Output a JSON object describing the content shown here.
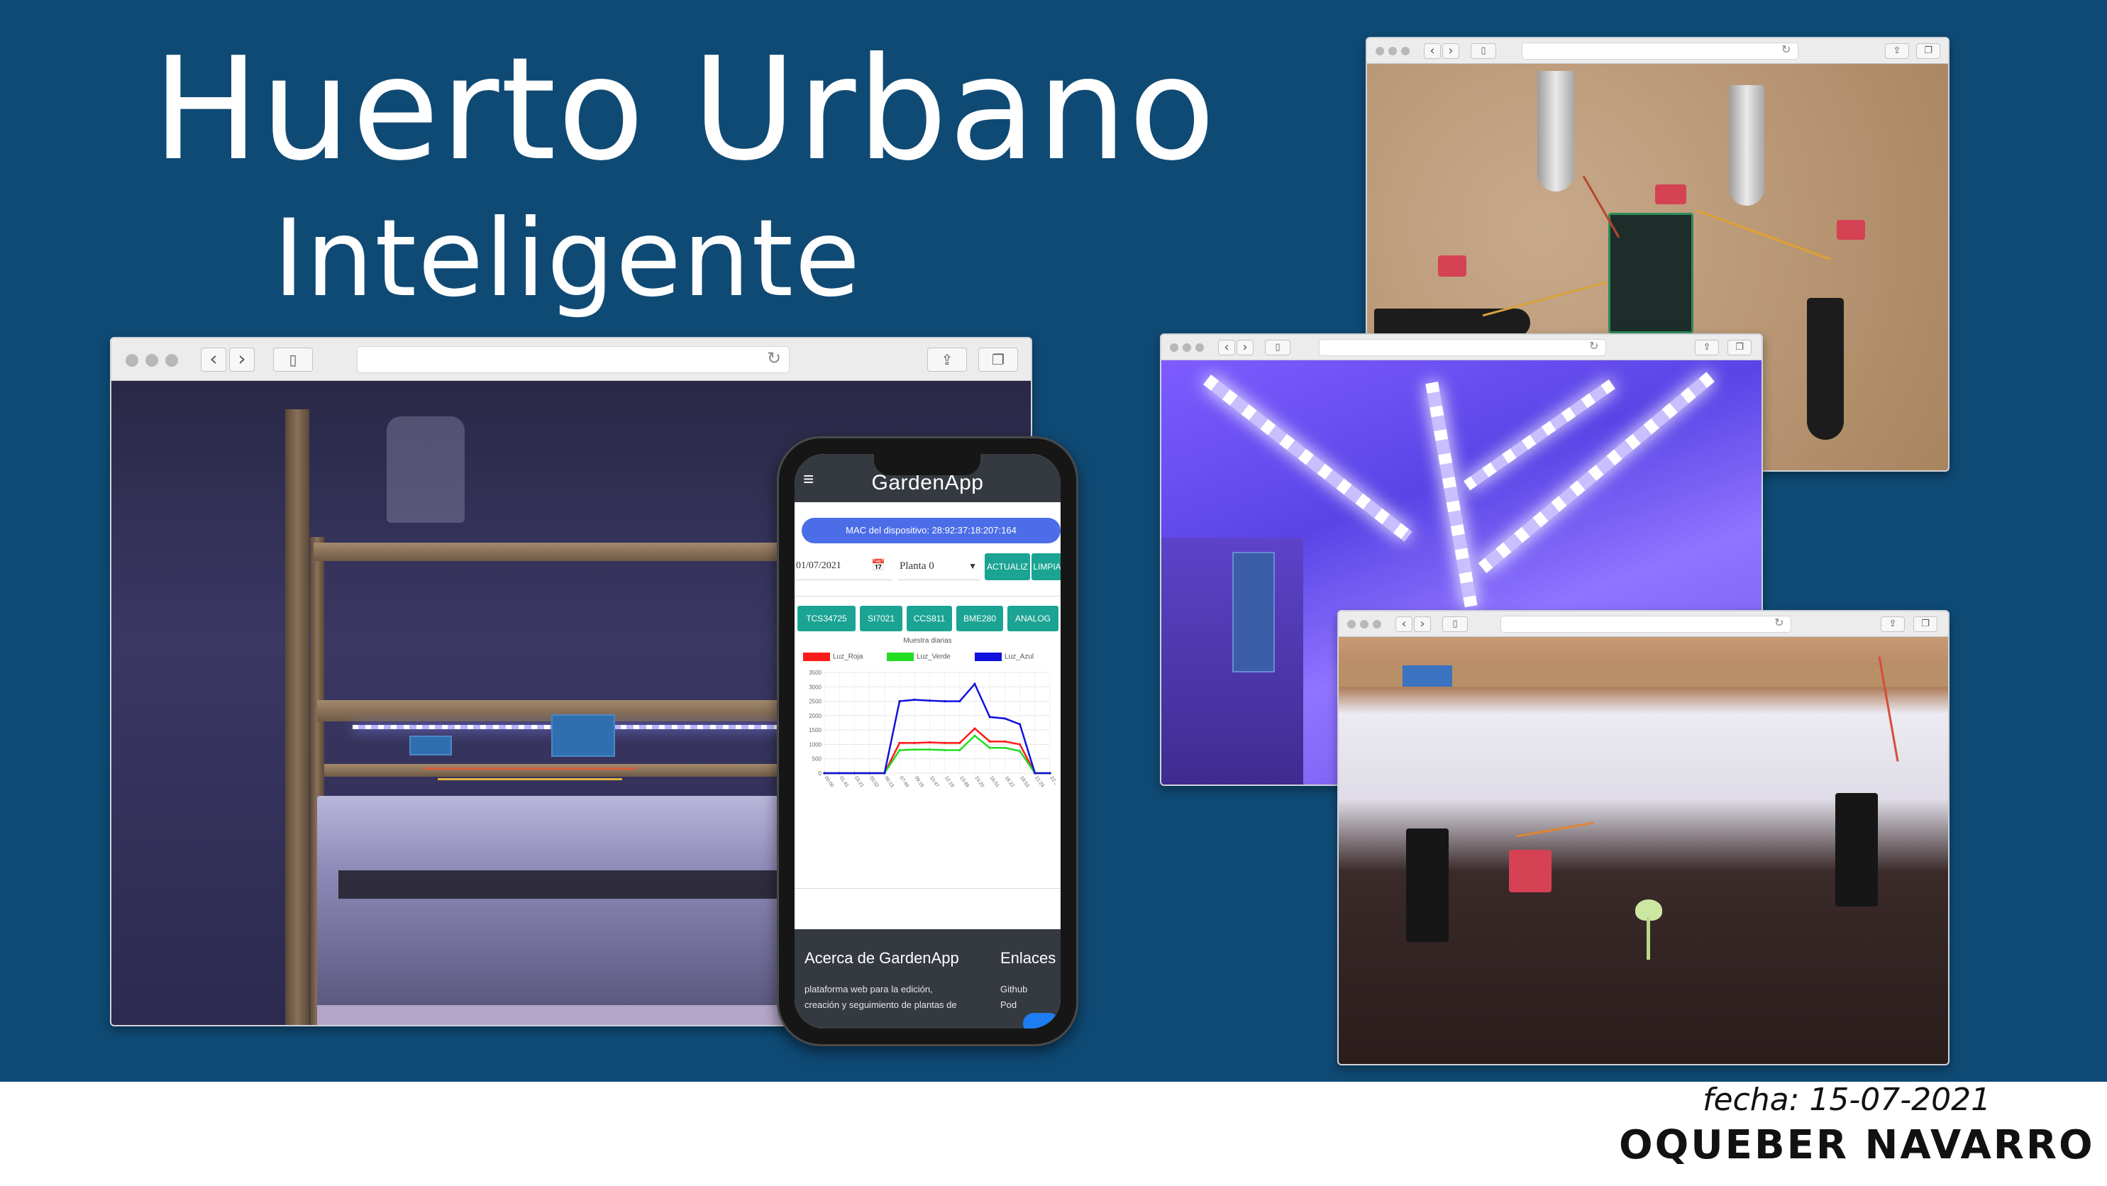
{
  "slide": {
    "title_line1": "Huerto Urbano",
    "title_line2": "Inteligente",
    "date_text": "fecha: 15-07-2021",
    "author": "OQUEBER NAVARRO",
    "colors": {
      "banner": "#0f4a75",
      "footer": "#ffffff"
    }
  },
  "browser": {
    "nav_back_icon": "chevron-left-icon",
    "nav_forward_icon": "chevron-right-icon",
    "reload_icon": "reload-icon",
    "share_icon": "share-icon",
    "tabs_icon": "tabs-icon",
    "back_glyph": "‹",
    "forward_glyph": "›",
    "reload_glyph": "↻",
    "share_glyph": "⇪",
    "tabs_glyph": "❐",
    "sidebar_glyph": "▯"
  },
  "app": {
    "title": "GardenApp",
    "menu_glyph": "≡",
    "mac_label": "MAC del dispositivo: 28:92:37:18:207:164",
    "date_value": "01/07/2021",
    "calendar_glyph": "📅",
    "plant_value": "Planta 0",
    "caret_glyph": "▼",
    "buttons_top": [
      "ACTUALIZ",
      "LIMPIA"
    ],
    "sensor_tabs": [
      "TCS34725",
      "SI7021",
      "CCS811",
      "BME280",
      "ANALOG"
    ],
    "chart_title": "Muestra diarias",
    "footer_about_title": "Acerca de GardenApp",
    "footer_about_text_1": "plataforma web para la edición,",
    "footer_about_text_2": "creación y seguimiento de plantas de",
    "footer_links_title": "Enlaces",
    "footer_link_1": "Github",
    "footer_link_2": "Pod",
    "colors": {
      "header": "#343a40",
      "mac_pill": "#4c6de8",
      "buttons": "#1ba493"
    }
  },
  "chart_data": {
    "type": "line",
    "title": "Muestra diarias",
    "xlabel": "",
    "ylabel": "",
    "ylim": [
      0,
      3500
    ],
    "yticks": [
      0,
      500,
      1000,
      1500,
      2000,
      2500,
      3000,
      3500
    ],
    "x": [
      "00:00",
      "01:41",
      "03:21",
      "05:02",
      "06:13",
      "07:44",
      "09:16",
      "10:47",
      "12:19",
      "13:49",
      "15:20",
      "16:51",
      "18:22",
      "19:53",
      "21:24",
      "22:55"
    ],
    "series": [
      {
        "name": "Luz_Roja",
        "color": "#ff1a1a",
        "values": [
          0,
          0,
          0,
          0,
          0,
          1050,
          1050,
          1070,
          1050,
          1050,
          1550,
          1100,
          1100,
          1000,
          0,
          0
        ]
      },
      {
        "name": "Luz_Verde",
        "color": "#22dd22",
        "values": [
          0,
          0,
          0,
          0,
          0,
          800,
          820,
          820,
          800,
          800,
          1300,
          880,
          880,
          770,
          0,
          0
        ]
      },
      {
        "name": "Luz_Azul",
        "color": "#1111dd",
        "values": [
          0,
          0,
          0,
          0,
          0,
          2500,
          2550,
          2520,
          2500,
          2500,
          3100,
          1950,
          1900,
          1700,
          0,
          0
        ]
      }
    ],
    "grid": true,
    "legend": "top"
  }
}
